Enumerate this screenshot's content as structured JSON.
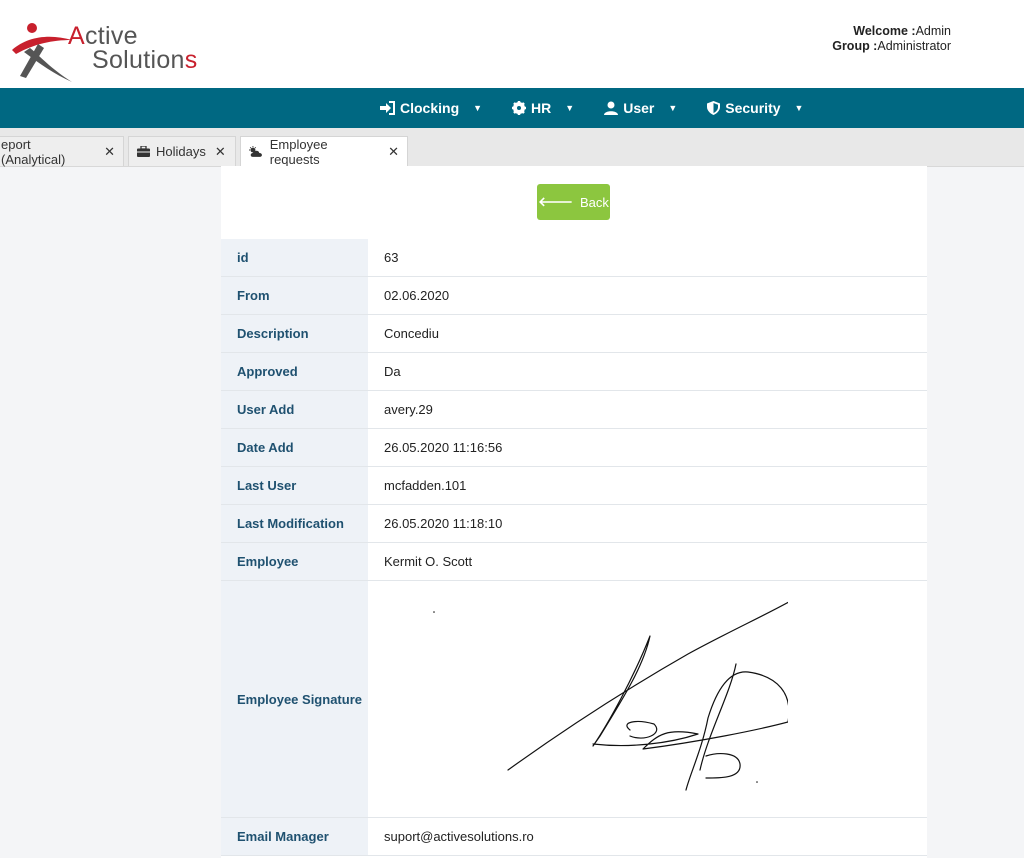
{
  "header": {
    "logo_word1": "Active",
    "logo_word2": "Solutions",
    "welcome_label": "Welcome :",
    "welcome_value": "Admin",
    "group_label": "Group :",
    "group_value": "Administrator"
  },
  "nav": {
    "items": [
      {
        "label": "Clocking",
        "icon": "sign-in-icon"
      },
      {
        "label": "HR",
        "icon": "gear-icon"
      },
      {
        "label": "User",
        "icon": "user-icon"
      },
      {
        "label": "Security",
        "icon": "shield-icon"
      }
    ]
  },
  "tabs": [
    {
      "label": "eport (Analytical)",
      "active": false
    },
    {
      "label": "Holidays",
      "icon": "briefcase-icon",
      "active": false
    },
    {
      "label": "Employee requests",
      "icon": "cloud-sun-icon",
      "active": true
    }
  ],
  "back_label": "Back",
  "details": [
    {
      "label": "id",
      "value": "63"
    },
    {
      "label": "From",
      "value": "02.06.2020"
    },
    {
      "label": "Description",
      "value": "Concediu"
    },
    {
      "label": "Approved",
      "value": "Da"
    },
    {
      "label": "User Add",
      "value": "avery.29"
    },
    {
      "label": "Date Add",
      "value": "26.05.2020 11:16:56"
    },
    {
      "label": "Last User",
      "value": "mcfadden.101"
    },
    {
      "label": "Last Modification",
      "value": "26.05.2020 11:18:10"
    },
    {
      "label": "Employee",
      "value": "Kermit O. Scott"
    },
    {
      "label": "Employee Signature",
      "value": ""
    },
    {
      "label": "Email Manager",
      "value": "suport@activesolutions.ro"
    }
  ],
  "colors": {
    "navbar": "#006882",
    "back_button": "#8cc63f",
    "label_text": "#1f5170",
    "brand_red": "#c8202d"
  }
}
